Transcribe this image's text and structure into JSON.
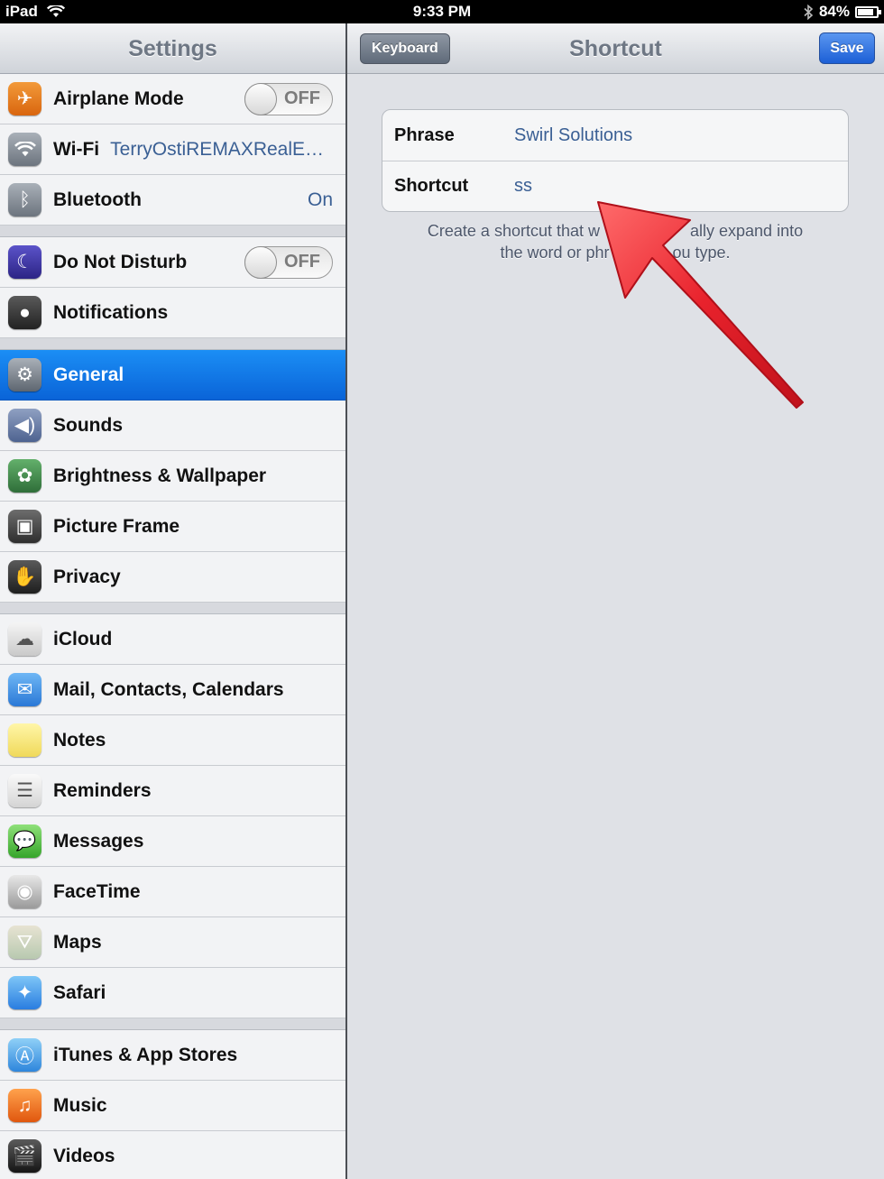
{
  "status_bar": {
    "device": "iPad",
    "time": "9:33 PM",
    "battery": "84%",
    "battery_level": 0.84
  },
  "master": {
    "title": "Settings",
    "groups": [
      [
        {
          "label": "Airplane Mode",
          "icon": "airplane-icon",
          "toggle": "OFF"
        },
        {
          "label": "Wi-Fi",
          "icon": "wifi-icon",
          "detail": "TerryOstiREMAXRealE…"
        },
        {
          "label": "Bluetooth",
          "icon": "bluetooth-icon",
          "detail": "On"
        }
      ],
      [
        {
          "label": "Do Not Disturb",
          "icon": "moon-icon",
          "toggle": "OFF"
        },
        {
          "label": "Notifications",
          "icon": "notifications-icon"
        }
      ],
      [
        {
          "label": "General",
          "icon": "gear-icon",
          "selected": true
        },
        {
          "label": "Sounds",
          "icon": "speaker-icon"
        },
        {
          "label": "Brightness & Wallpaper",
          "icon": "flower-icon"
        },
        {
          "label": "Picture Frame",
          "icon": "picture-frame-icon"
        },
        {
          "label": "Privacy",
          "icon": "hand-icon"
        }
      ],
      [
        {
          "label": "iCloud",
          "icon": "cloud-icon"
        },
        {
          "label": "Mail, Contacts, Calendars",
          "icon": "mail-icon"
        },
        {
          "label": "Notes",
          "icon": "notes-icon"
        },
        {
          "label": "Reminders",
          "icon": "reminders-icon"
        },
        {
          "label": "Messages",
          "icon": "messages-icon"
        },
        {
          "label": "FaceTime",
          "icon": "facetime-icon"
        },
        {
          "label": "Maps",
          "icon": "maps-icon"
        },
        {
          "label": "Safari",
          "icon": "compass-icon"
        }
      ],
      [
        {
          "label": "iTunes & App Stores",
          "icon": "app-store-icon"
        },
        {
          "label": "Music",
          "icon": "music-icon"
        },
        {
          "label": "Videos",
          "icon": "videos-icon"
        }
      ]
    ]
  },
  "detail": {
    "title": "Shortcut",
    "back_label": "Keyboard",
    "save_label": "Save",
    "phrase_label": "Phrase",
    "phrase_value": "Swirl Solutions",
    "shortcut_label": "Shortcut",
    "shortcut_value": "ss",
    "footer_line1": "Create a shortcut that w",
    "footer_line1_end": "ally expand into",
    "footer_line2": "the word or phr",
    "footer_line2_end": "ou type."
  },
  "colors": {
    "selected_row": "#0a64d8",
    "detail_text": "#3a5f94",
    "arrow": "#e8222c"
  }
}
